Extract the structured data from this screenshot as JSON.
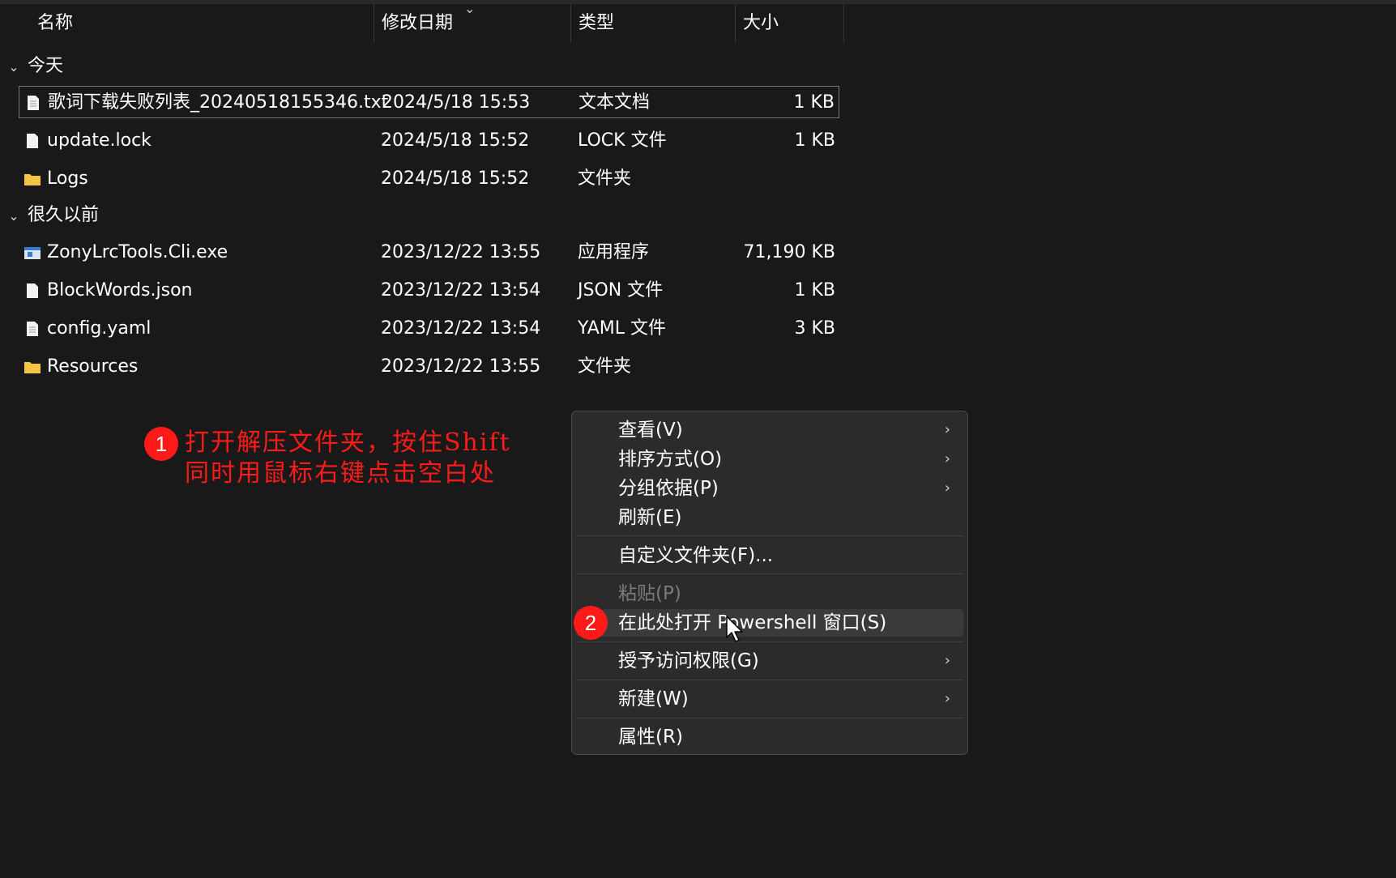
{
  "columns": {
    "name": "名称",
    "date": "修改日期",
    "type": "类型",
    "size": "大小"
  },
  "groups": [
    {
      "label": "今天"
    },
    {
      "label": "很久以前"
    }
  ],
  "files": [
    {
      "name": "歌词下载失败列表_20240518155346.txt",
      "date": "2024/5/18 15:53",
      "type": "文本文档",
      "size": "1 KB",
      "icon": "text-file-icon"
    },
    {
      "name": "update.lock",
      "date": "2024/5/18 15:52",
      "type": "LOCK 文件",
      "size": "1 KB",
      "icon": "file-icon"
    },
    {
      "name": "Logs",
      "date": "2024/5/18 15:52",
      "type": "文件夹",
      "size": "",
      "icon": "folder-icon"
    },
    {
      "name": "ZonyLrcTools.Cli.exe",
      "date": "2023/12/22 13:55",
      "type": "应用程序",
      "size": "71,190 KB",
      "icon": "exe-icon"
    },
    {
      "name": "BlockWords.json",
      "date": "2023/12/22 13:54",
      "type": "JSON 文件",
      "size": "1 KB",
      "icon": "file-icon"
    },
    {
      "name": "config.yaml",
      "date": "2023/12/22 13:54",
      "type": "YAML 文件",
      "size": "3 KB",
      "icon": "text-file-icon"
    },
    {
      "name": "Resources",
      "date": "2023/12/22 13:55",
      "type": "文件夹",
      "size": "",
      "icon": "folder-icon"
    }
  ],
  "annotation1": {
    "badge": "1",
    "line1": "打开解压文件夹，按住Shift",
    "line2": "同时用鼠标右键点击空白处"
  },
  "annotation2": {
    "badge": "2"
  },
  "menu": {
    "items": [
      {
        "label": "查看(V)",
        "submenu": true
      },
      {
        "label": "排序方式(O)",
        "submenu": true
      },
      {
        "label": "分组依据(P)",
        "submenu": true
      },
      {
        "label": "刷新(E)",
        "submenu": false
      },
      {
        "label": "自定义文件夹(F)...",
        "submenu": false
      },
      {
        "label": "粘贴(P)",
        "submenu": false,
        "disabled": true
      },
      {
        "label": "在此处打开 Powershell 窗口(S)",
        "submenu": false,
        "highlighted": true
      },
      {
        "label": "授予访问权限(G)",
        "submenu": true
      },
      {
        "label": "新建(W)",
        "submenu": true
      },
      {
        "label": "属性(R)",
        "submenu": false
      }
    ],
    "arrow_glyph": "›"
  },
  "colors": {
    "background": "#191919",
    "menu_bg": "#2b2b2b",
    "annotation_red": "#ff1a1a",
    "folder": "#f6c544"
  }
}
